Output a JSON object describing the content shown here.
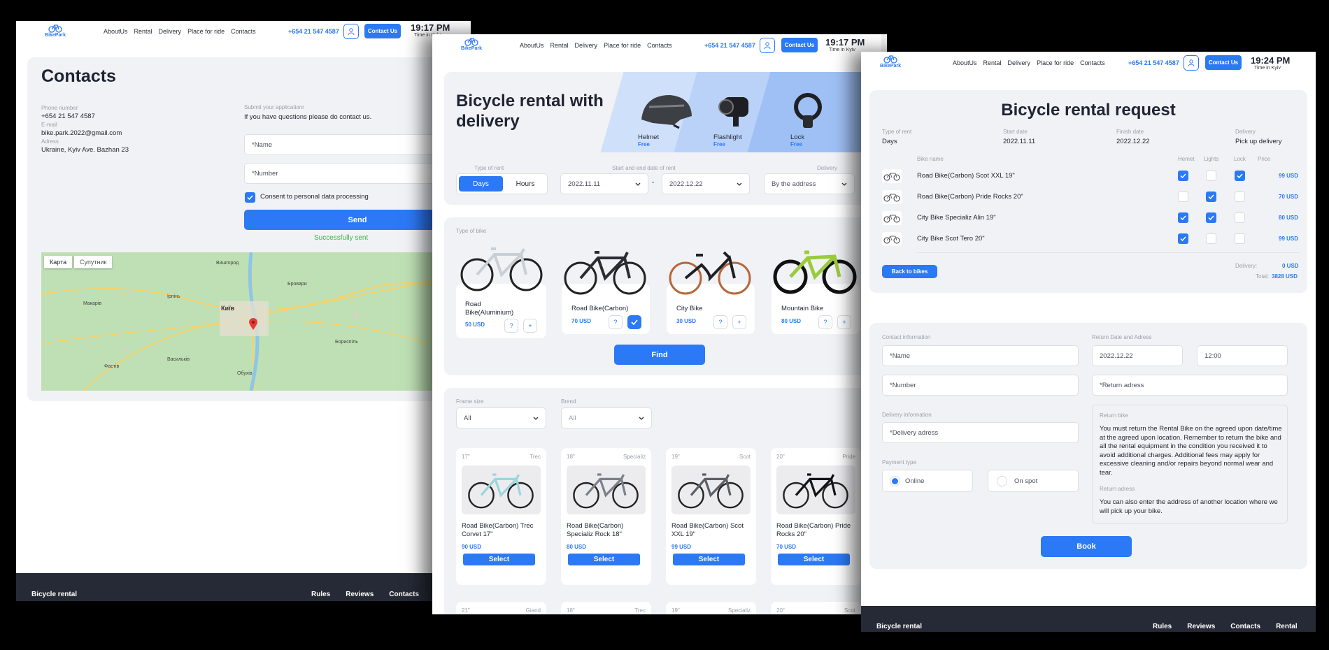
{
  "header": {
    "logo": "BikePark",
    "nav": [
      "AboutUs",
      "Rental",
      "Delivery",
      "Place for ride",
      "Contacts"
    ],
    "phone": "+654 21 547 4587",
    "contact_btn": "Contact Us",
    "time_sub": "Time in Kyiv"
  },
  "times": {
    "w1": "19:17 PM",
    "w2": "19:17 PM",
    "w3": "19:24 PM"
  },
  "contacts": {
    "title": "Contacts",
    "phone_label": "Phone number",
    "phone": "+654 21 547 4587",
    "email_label": "E-mail",
    "email": "bike.park.2022@gmail.com",
    "address_label": "Adress",
    "address": "Ukraine, Kyiv Ave. Bazhan 23",
    "submit_label": "Submit your applicationr",
    "submit_text": "If you have questions please do contact us.",
    "name_ph": "*Name",
    "number_ph": "*Number",
    "consent": "Consent to personal data processing",
    "send": "Send",
    "success": "Successfully sent",
    "map_tabs": [
      "Карта",
      "Супутник"
    ],
    "map_city": "Київ",
    "map_places": [
      "Бровари",
      "Вишгород",
      "Ірпінь",
      "Бориспіль",
      "Обухів",
      "Фастів",
      "Макарів",
      "Васильків"
    ]
  },
  "footer": {
    "title": "Bicycle rental",
    "links": [
      "Rules",
      "Reviews",
      "Contacts",
      "Rental"
    ]
  },
  "rental": {
    "title_line1": "Bicycle rental with",
    "title_line2": "delivery",
    "accessories": [
      {
        "name": "Helmet",
        "tag": "Free"
      },
      {
        "name": "Flashlight",
        "tag": "Free"
      },
      {
        "name": "Lock",
        "tag": "Free"
      }
    ],
    "type_of_rent_label": "Type of rent",
    "rent_days": "Days",
    "rent_hours": "Hours",
    "dates_label": "Start and end date of rent",
    "start_date": "2022.11.11",
    "end_date": "2022.12.22",
    "delivery_label": "Delivery",
    "delivery_value": "By the address",
    "type_of_bike_label": "Type of bike",
    "bike_types": [
      {
        "name": "Road Bike(Aluminium)",
        "price": "50 USD",
        "selected": false
      },
      {
        "name": "Road Bike(Carbon)",
        "price": "70 USD",
        "selected": true
      },
      {
        "name": "City Bike",
        "price": "30 USD",
        "selected": false
      },
      {
        "name": "Mountain Bike",
        "price": "80 USD",
        "selected": false
      }
    ],
    "find": "Find",
    "frame_label": "Frame size",
    "frame_value": "All",
    "brand_label": "Brend",
    "brand_value": "All",
    "products": [
      {
        "size": "17\"",
        "brand": "Trec",
        "name": "Road Bike(Carbon) Trec Corvet 17\"",
        "price": "90 USD"
      },
      {
        "size": "18\"",
        "brand": "Specializ",
        "name": "Road Bike(Carbon) Specializ Rock 18\"",
        "price": "80 USD"
      },
      {
        "size": "19\"",
        "brand": "Scot",
        "name": "Road Bike(Carbon) Scot XXL 19\"",
        "price": "99 USD"
      },
      {
        "size": "20\"",
        "brand": "Pride",
        "name": "Road Bike(Carbon) Pride Rocks 20\"",
        "price": "70 USD"
      }
    ],
    "select": "Select",
    "next_row": [
      {
        "size": "21\"",
        "brand": "Giand"
      },
      {
        "size": "18\"",
        "brand": "Trec"
      },
      {
        "size": "19\"",
        "brand": "Specializ"
      },
      {
        "size": "20\"",
        "brand": "Scot"
      }
    ]
  },
  "request": {
    "title": "Bicycle rental request",
    "type_label": "Type of rent",
    "type_value": "Days",
    "start_label": "Start date",
    "start_value": "2022.11.11",
    "finish_label": "Finish date",
    "finish_value": "2022.12.22",
    "delivery_label": "Delivery",
    "delivery_value": "Pick up delivery",
    "cols": [
      "Bike name",
      "Hemet",
      "Lights",
      "Lock",
      "Price"
    ],
    "rows": [
      {
        "name": "Road Bike(Carbon) Scot XXL 19\"",
        "helmet": true,
        "lights": false,
        "lock": true,
        "price": "99 USD"
      },
      {
        "name": "Road Bike(Carbon) Pride Rocks 20\"",
        "helmet": false,
        "lights": true,
        "lock": false,
        "price": "70 USD"
      },
      {
        "name": "City Bike Specializ Alin 19\"",
        "helmet": true,
        "lights": true,
        "lock": false,
        "price": "80 USD"
      },
      {
        "name": "City Bike Scot Tero 20\"",
        "helmet": true,
        "lights": false,
        "lock": false,
        "price": "99 USD"
      }
    ],
    "back": "Back to bikes",
    "delivery_cost_label": "Delivery:",
    "delivery_cost": "0 USD",
    "total_label": "Total:",
    "total": "3828 USD",
    "contact_label": "Contact information",
    "name_ph": "*Name",
    "number_ph": "*Number",
    "delivery_info_label": "Delivery information",
    "delivery_adress_ph": "*Delivery adress",
    "payment_label": "Payment type",
    "pay_online": "Online",
    "pay_spot": "On spot",
    "return_label": "Return Date and Adress",
    "return_date": "2022.12.22",
    "return_time": "12:00",
    "return_adress_ph": "*Return adress",
    "return_bike_title": "Return bike",
    "return_bike_text": "You must return the Rental Bike on the agreed upon date/time at the agreed upon location. Remember to return the bike and all the rental equipment in the condition you received it to avoid additional charges. Additional fees may apply for excessive cleaning and/or repairs beyond normal wear and tear.",
    "return_adress_title": "Return adress",
    "return_adress_text": "You can also enter the address of another location where we will pick up your bike.",
    "book": "Book"
  }
}
